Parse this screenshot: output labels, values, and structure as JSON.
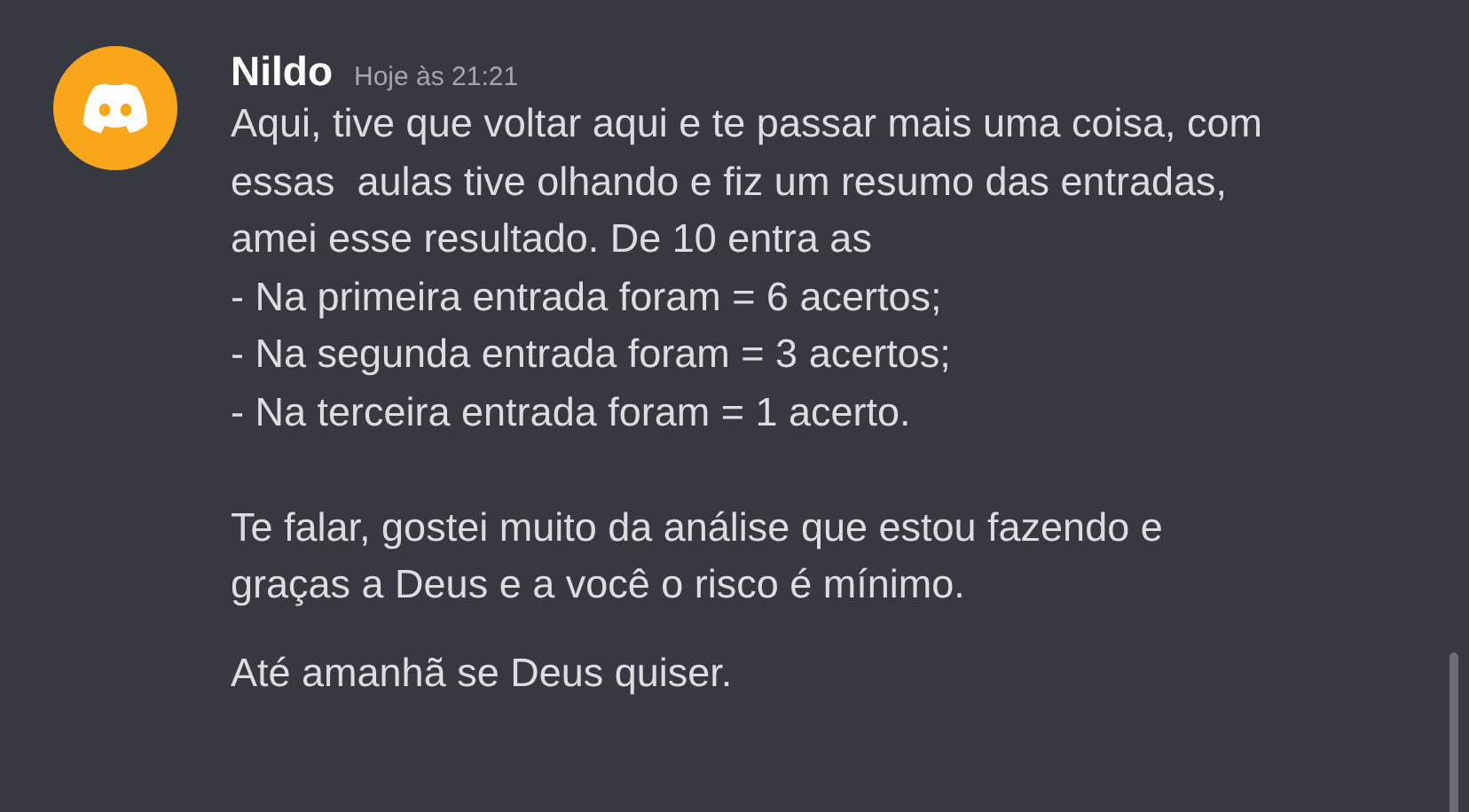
{
  "author": {
    "name": "Nildo",
    "timestamp": "Hoje às 21:21"
  },
  "messages": [
    {
      "text": "Aqui, tive que voltar aqui e te passar mais uma coisa, com\nessas  aulas tive olhando e fiz um resumo das entradas,\namei esse resultado. De 10 entra as\n- Na primeira entrada foram = 6 acertos;\n- Na segunda entrada foram = 3 acertos;\n- Na terceira entrada foram = 1 acerto.\n\nTe falar, gostei muito da análise que estou fazendo e\ngraças a Deus e a você o risco é mínimo."
    },
    {
      "text": "Até amanhã se Deus quiser."
    }
  ]
}
